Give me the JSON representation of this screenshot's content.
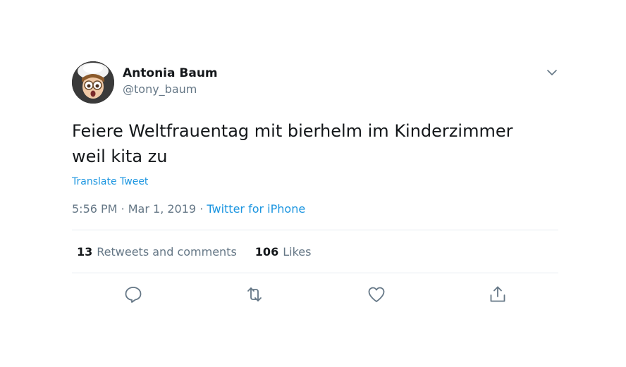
{
  "author": {
    "display_name": "Antonia Baum",
    "handle": "@tony_baum"
  },
  "tweet": {
    "text_line1": "Feiere Weltfrauentag mit bierhelm im Kinderzimmer",
    "text_line2": "weil kita zu",
    "translate_label": "Translate Tweet",
    "time": "5:56 PM",
    "separator": "·",
    "date": "Mar 1, 2019",
    "source": "Twitter for iPhone"
  },
  "stats": {
    "retweets_count": "13",
    "retweets_label": "Retweets and comments",
    "likes_count": "106",
    "likes_label": "Likes"
  },
  "icons": {
    "caret": "chevron-down-icon",
    "reply": "reply-icon",
    "retweet": "retweet-icon",
    "like": "heart-icon",
    "share": "share-icon"
  },
  "colors": {
    "link": "#1b95e0",
    "secondary_text": "#657786",
    "primary_text": "#14171a",
    "divider": "#e6ecf0"
  }
}
